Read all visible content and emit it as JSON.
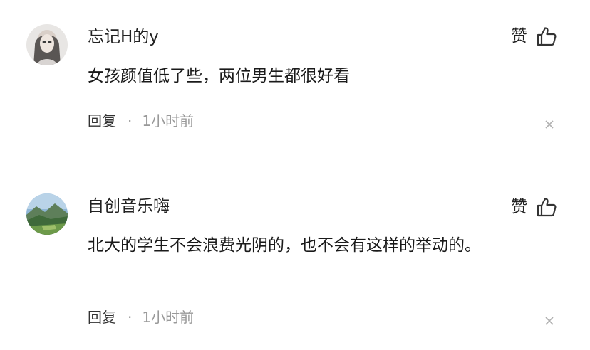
{
  "comments": [
    {
      "avatar_icon": "user-avatar-portrait",
      "username": "忘记H的y",
      "like_label": "赞",
      "like_icon": "thumbs-up-icon",
      "text": "女孩颜值低了些，两位男生都很好看",
      "reply_label": "回复",
      "separator": "·",
      "time": "1小时前",
      "close_icon": "close-icon"
    },
    {
      "avatar_icon": "user-avatar-landscape",
      "username": "自创音乐嗨",
      "like_label": "赞",
      "like_icon": "thumbs-up-icon",
      "text": "北大的学生不会浪费光阴的，也不会有这样的举动的。",
      "reply_label": "回复",
      "separator": "·",
      "time": "1小时前",
      "close_icon": "close-icon"
    }
  ],
  "colors": {
    "text_primary": "#222222",
    "text_secondary": "#999999",
    "background": "#ffffff"
  }
}
